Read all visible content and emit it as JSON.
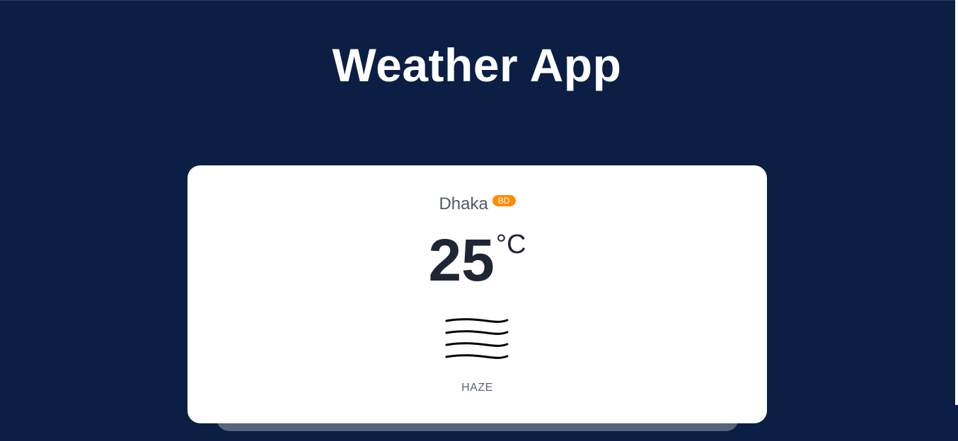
{
  "app": {
    "title": "Weather App"
  },
  "weather": {
    "city": "Dhaka",
    "country": "BD",
    "temperature": "25",
    "unit": "°C",
    "description": "HAZE",
    "icon": "haze-icon"
  },
  "colors": {
    "background": "#0b1f45",
    "card": "#ffffff",
    "badge": "#ff8c00",
    "temperature_text": "#1f2633"
  }
}
